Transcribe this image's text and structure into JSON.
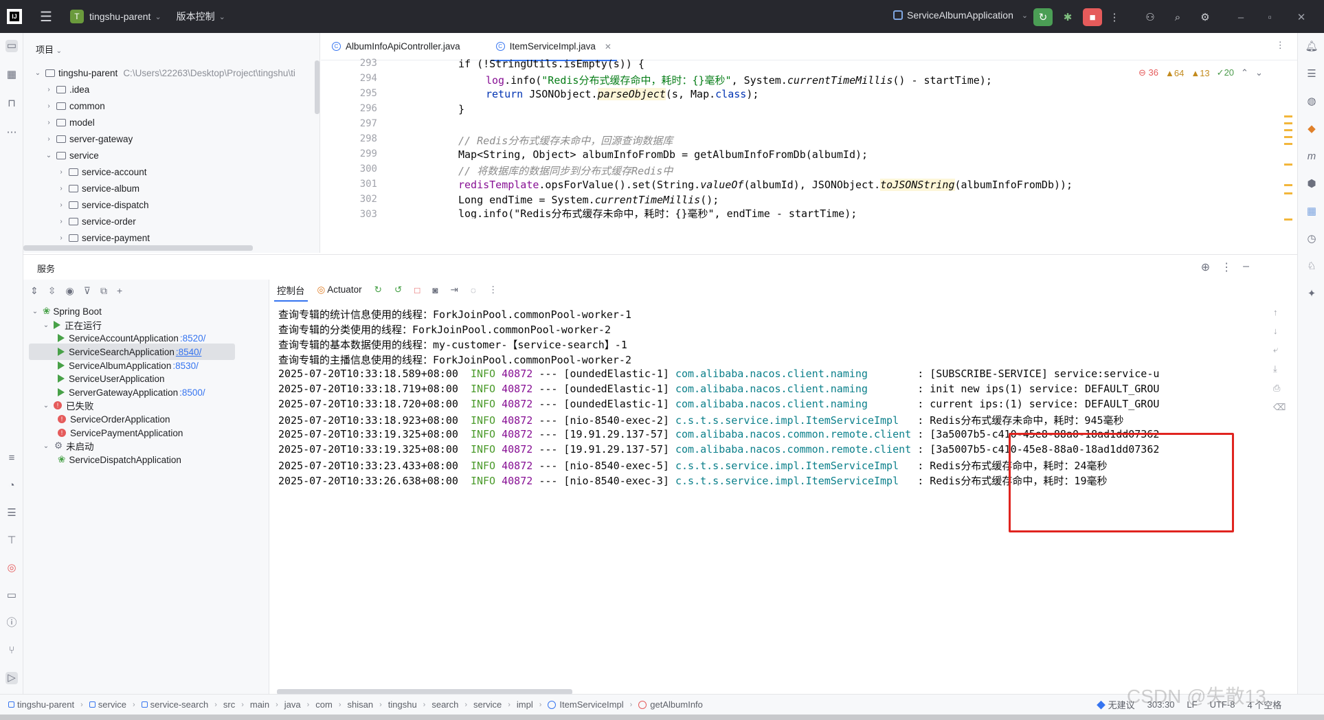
{
  "topbar": {
    "project_badge": "T",
    "project_name": "tingshu-parent",
    "vcs_label": "版本控制",
    "run_config": "ServiceAlbumApplication"
  },
  "project_panel": {
    "title": "项目",
    "root_name": "tingshu-parent",
    "root_path": "C:\\Users\\22263\\Desktop\\Project\\tingshu\\ti",
    "items": [
      ".idea",
      "common",
      "model",
      "server-gateway",
      "service"
    ],
    "service_children": [
      "service-account",
      "service-album",
      "service-dispatch",
      "service-order",
      "service-payment"
    ]
  },
  "editor": {
    "tabs": [
      "AlbumInfoApiController.java",
      "ItemServiceImpl.java"
    ],
    "inspections": {
      "errors": "36",
      "warnings": "64",
      "weak": "13",
      "ok": "20"
    },
    "line_numbers": [
      "293",
      "294",
      "295",
      "296",
      "297",
      "298",
      "299",
      "300",
      "301",
      "302",
      "303"
    ],
    "code": {
      "l293": "if (!StringUtils.isEmpty(s)) {",
      "l294_a": "log",
      "l294_b": ".info(",
      "l294_c": "\"Redis分布式缓存命中，耗时：{}毫秒\"",
      "l294_d": ", System.",
      "l294_e": "currentTimeMillis",
      "l294_f": "() - startTime);",
      "l295_a": "return ",
      "l295_b": "JSONObject.",
      "l295_c": "parseObject",
      "l295_d": "(s, Map.",
      "l295_e": "class",
      "l295_f": ");",
      "l296": "}",
      "l298": "// Redis分布式缓存未命中，回源查询数据库",
      "l299": "Map<String, Object> albumInfoFromDb = getAlbumInfoFromDb(albumId);",
      "l300": "// 将数据库的数据同步到分布式缓存Redis中",
      "l301_a": "redisTemplate",
      "l301_b": ".opsForValue().set(String.",
      "l301_c": "valueOf",
      "l301_d": "(albumId), JSONObject.",
      "l301_e": "toJSONString",
      "l301_f": "(albumInfoFromDb));",
      "l302_a": "Long endTime = System.",
      "l302_b": "currentTimeMillis",
      "l302_c": "();",
      "l303": "log.info(\"Redis分布式缓存未命中，耗时：{}毫秒\", endTime - startTime);"
    }
  },
  "services": {
    "title": "服务",
    "root": "Spring Boot",
    "groups": {
      "running": "正在运行",
      "failed": "已失败",
      "not_started": "未启动"
    },
    "running_apps": [
      {
        "name": "ServiceAccountApplication",
        "port": ":8520/"
      },
      {
        "name": "ServiceSearchApplication",
        "port": ":8540/"
      },
      {
        "name": "ServiceAlbumApplication",
        "port": ":8530/"
      },
      {
        "name": "ServiceUserApplication",
        "port": ""
      },
      {
        "name": "ServerGatewayApplication",
        "port": ":8500/"
      }
    ],
    "failed_apps": [
      "ServiceOrderApplication",
      "ServicePaymentApplication"
    ],
    "not_started_apps": [
      "ServiceDispatchApplication"
    ]
  },
  "console": {
    "tabs": [
      "控制台",
      "Actuator"
    ],
    "plain_lines": [
      "查询专辑的统计信息使用的线程：ForkJoinPool.commonPool-worker-1",
      "查询专辑的分类使用的线程：ForkJoinPool.commonPool-worker-2",
      "查询专辑的基本数据使用的线程：my-customer-【service-search】-1",
      "查询专辑的主播信息使用的线程：ForkJoinPool.commonPool-worker-2"
    ],
    "log_lines": [
      {
        "ts": "2025-07-20T10:33:18.589+08:00",
        "level": "INFO",
        "pid": "40872",
        "thread": "--- [oundedElastic-1]",
        "logger": "com.alibaba.nacos.client.naming        ",
        "msg": ": [SUBSCRIBE-SERVICE] service:service-u"
      },
      {
        "ts": "2025-07-20T10:33:18.719+08:00",
        "level": "INFO",
        "pid": "40872",
        "thread": "--- [oundedElastic-1]",
        "logger": "com.alibaba.nacos.client.naming        ",
        "msg": ": init new ips(1) service: DEFAULT_GROU"
      },
      {
        "ts": "2025-07-20T10:33:18.720+08:00",
        "level": "INFO",
        "pid": "40872",
        "thread": "--- [oundedElastic-1]",
        "logger": "com.alibaba.nacos.client.naming        ",
        "msg": ": current ips:(1) service: DEFAULT_GROU"
      },
      {
        "ts": "2025-07-20T10:33:18.923+08:00",
        "level": "INFO",
        "pid": "40872",
        "thread": "--- [nio-8540-exec-2]",
        "logger": "c.s.t.s.service.impl.ItemServiceImpl   ",
        "msg": ": Redis分布式缓存未命中，耗时：945毫秒"
      },
      {
        "ts": "2025-07-20T10:33:19.325+08:00",
        "level": "INFO",
        "pid": "40872",
        "thread": "--- [19.91.29.137-57]",
        "logger": "com.alibaba.nacos.common.remote.client ",
        "msg": ": [3a5007b5-c410-45e8-88a0-18ad1dd07362"
      },
      {
        "ts": "2025-07-20T10:33:19.325+08:00",
        "level": "INFO",
        "pid": "40872",
        "thread": "--- [19.91.29.137-57]",
        "logger": "com.alibaba.nacos.common.remote.client ",
        "msg": ": [3a5007b5-c410-45e8-88a0-18ad1dd07362"
      },
      {
        "ts": "2025-07-20T10:33:23.433+08:00",
        "level": "INFO",
        "pid": "40872",
        "thread": "--- [nio-8540-exec-5]",
        "logger": "c.s.t.s.service.impl.ItemServiceImpl   ",
        "msg": ": Redis分布式缓存命中，耗时：24毫秒"
      },
      {
        "ts": "2025-07-20T10:33:26.638+08:00",
        "level": "INFO",
        "pid": "40872",
        "thread": "--- [nio-8540-exec-3]",
        "logger": "c.s.t.s.service.impl.ItemServiceImpl   ",
        "msg": ": Redis分布式缓存命中，耗时：19毫秒"
      }
    ]
  },
  "statusbar": {
    "breadcrumb": [
      "tingshu-parent",
      "service",
      "service-search",
      "src",
      "main",
      "java",
      "com",
      "shisan",
      "tingshu",
      "search",
      "service",
      "impl",
      "ItemServiceImpl",
      "getAlbumInfo"
    ],
    "suggestion": "无建议",
    "position": "303:30",
    "line_sep": "LF",
    "encoding": "UTF-8",
    "indent": "4 个空格"
  },
  "watermark": "CSDN @失散13",
  "colors": {
    "accent": "#3574f0",
    "highlight_box": "#e0241f",
    "run_green": "#48a148"
  }
}
